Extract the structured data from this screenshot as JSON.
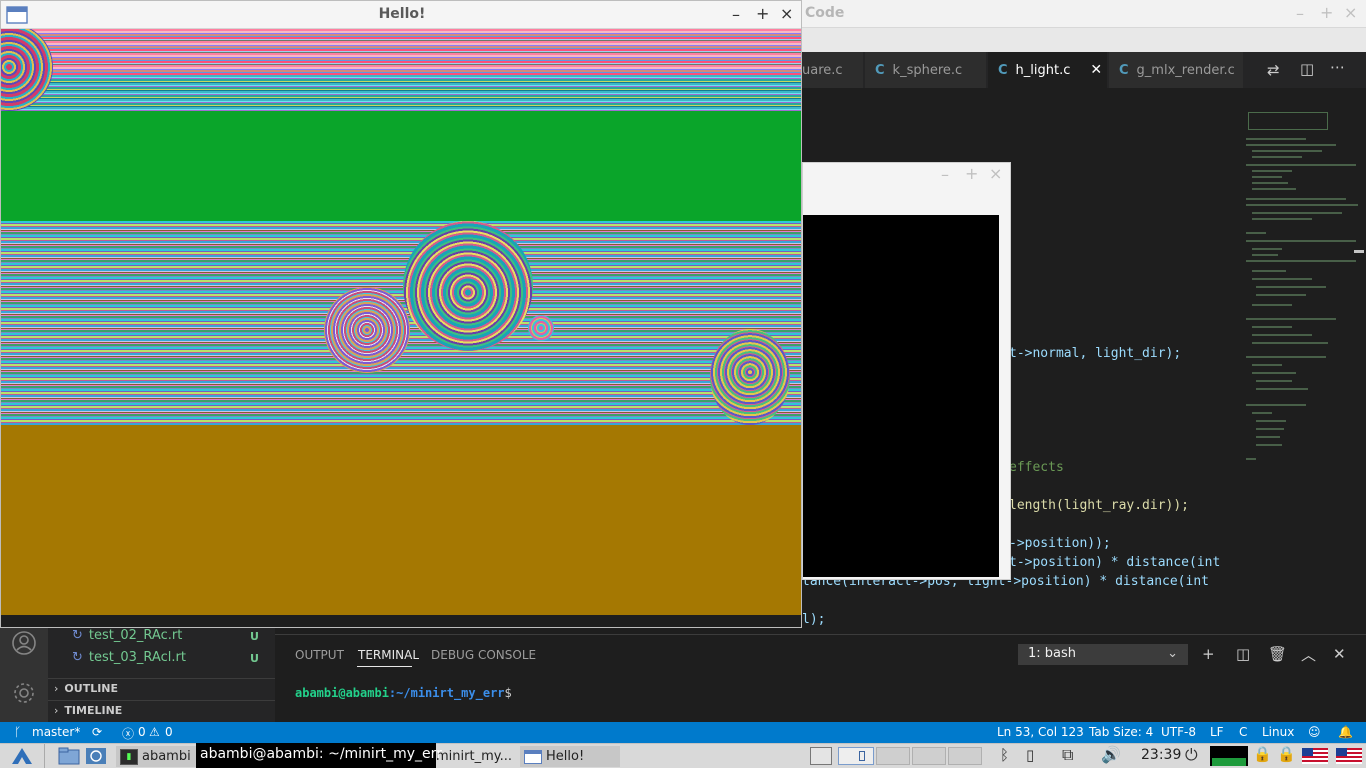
{
  "vscode": {
    "title": "Code",
    "tabs": [
      {
        "label": "uare.c",
        "icon": "C"
      },
      {
        "label": "k_sphere.c",
        "icon": "C"
      },
      {
        "label": "h_light.c",
        "icon": "C"
      },
      {
        "label": "g_mlx_render.c",
        "icon": "C"
      }
    ],
    "code_lines": [
      "t->normal, light_dir);",
      "effects",
      "length(light_ray.dir));",
      "->position));",
      "t->position) * distance(int",
      "tance(interact->pos, light->position) * distance(int",
      "l);"
    ],
    "files": [
      {
        "name": "test_02_RAc.rt",
        "status": "U"
      },
      {
        "name": "test_03_RAcl.rt",
        "status": "U"
      }
    ],
    "sections": {
      "outline": "OUTLINE",
      "timeline": "TIMELINE"
    },
    "panel": {
      "tabs": [
        "OUTPUT",
        "TERMINAL",
        "DEBUG CONSOLE"
      ],
      "shell": "1: bash",
      "prompt_user": "abambi@abambi",
      "prompt_path": ":~/minirt_my_err",
      "prompt_symbol": "$"
    },
    "status": {
      "branch": "master*",
      "problems": "0",
      "warnings": "0",
      "position": "Ln 53, Col 123",
      "tab_size": "Tab Size: 4",
      "encoding": "UTF-8",
      "eol": "LF",
      "language": "C",
      "os": "Linux"
    }
  },
  "hello_window": {
    "title": "Hello!"
  },
  "taskbar": {
    "items": [
      "abambi",
      "minirt_my...",
      "Hello!"
    ],
    "tooltip": "abambi@abambi: ~/minirt_my_err",
    "clock": "23:39"
  },
  "colors": {
    "statusbar": "#007acc",
    "green_band": "#0aa52a",
    "gold_band": "#a57802",
    "prompt_user": "#23d18b",
    "prompt_path": "#3b8eea"
  }
}
